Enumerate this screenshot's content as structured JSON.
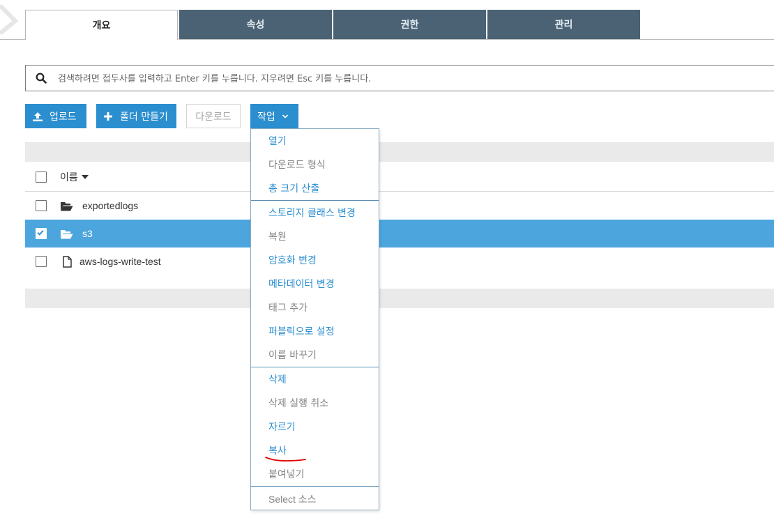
{
  "tabs": [
    {
      "label": "개요",
      "active": true
    },
    {
      "label": "속성",
      "active": false
    },
    {
      "label": "권한",
      "active": false
    },
    {
      "label": "관리",
      "active": false
    }
  ],
  "search": {
    "icon": "search-icon",
    "placeholder": "검색하려면 접두사를 입력하고 Enter 키를 누릅니다. 지우려면 Esc 키를 누릅니다.",
    "value": ""
  },
  "toolbar": {
    "upload_label": "업로드",
    "create_folder_label": "폴더 만들기",
    "download_label": "다운로드",
    "actions_label": "작업"
  },
  "table": {
    "column_name": "이름",
    "sort": "descending",
    "rows": [
      {
        "name": "exportedlogs",
        "type": "folder",
        "checked": false
      },
      {
        "name": "s3",
        "type": "folder",
        "checked": true
      },
      {
        "name": "aws-logs-write-test",
        "type": "file",
        "checked": false
      }
    ]
  },
  "actions_menu": {
    "groups": [
      [
        {
          "label": "열기",
          "enabled": true
        },
        {
          "label": "다운로드 형식",
          "enabled": false
        },
        {
          "label": "총 크기 산출",
          "enabled": true
        }
      ],
      [
        {
          "label": "스토리지 클래스 변경",
          "enabled": true
        },
        {
          "label": "복원",
          "enabled": false
        },
        {
          "label": "암호화 변경",
          "enabled": true
        },
        {
          "label": "메타데이터 변경",
          "enabled": true
        },
        {
          "label": "태그 추가",
          "enabled": false
        },
        {
          "label": "퍼블릭으로 설정",
          "enabled": true
        },
        {
          "label": "이름 바꾸기",
          "enabled": false
        }
      ],
      [
        {
          "label": "삭제",
          "enabled": true
        },
        {
          "label": "삭제 실행 취소",
          "enabled": false
        },
        {
          "label": "자르기",
          "enabled": true
        },
        {
          "label": "복사",
          "enabled": true
        },
        {
          "label": "붙여넣기",
          "enabled": false
        }
      ],
      [
        {
          "label": "Select 소스",
          "enabled": false
        }
      ]
    ]
  },
  "colors": {
    "accent": "#2b8ecf",
    "selected_row": "#4ca6dd",
    "tab_inactive": "#4a6274",
    "annotation": "#e00000"
  }
}
